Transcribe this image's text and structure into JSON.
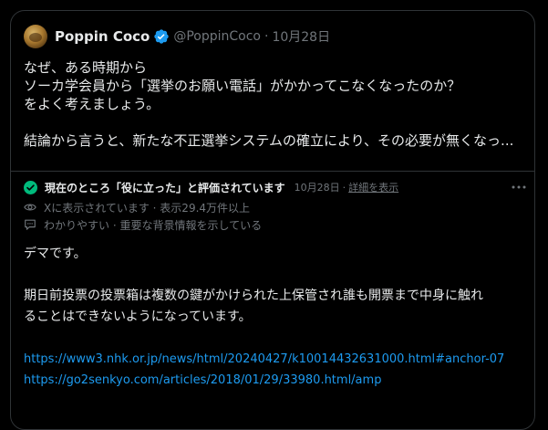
{
  "tweet": {
    "author": {
      "display_name": "Poppin Coco",
      "handle": "@PoppinCoco",
      "verified": true
    },
    "separator": "·",
    "date": "10月28日",
    "lines": [
      "なぜ、ある時期から",
      "ソーカ学会員から「選挙のお願い電話」がかかってこなくなったのか？",
      "をよく考えましょう。",
      "結論から言うと、新たな不正選挙システムの確立により、その必要が無くなっ..."
    ]
  },
  "community_note": {
    "status": "現在のところ「役に立った」と評価されています",
    "date": "10月28日",
    "separator": "·",
    "details_link": "詳細を表示",
    "views_text": "Xに表示されています · 表示29.4万件以上",
    "reason_text": "わかりやすい · 重要な背景情報を示している",
    "body": [
      "デマです。",
      "期日前投票の投票箱は複数の鍵がかけられた上保管され誰も開票まで中身に触れ",
      "ることはできないようになっています。"
    ],
    "links": [
      "https://www3.nhk.or.jp/news/html/20240427/k10014432631000.html#anchor-07",
      "https://go2senkyo.com/articles/2018/01/29/33980.html/amp"
    ]
  },
  "colors": {
    "background": "#000000",
    "text_primary": "#e7e9ea",
    "text_secondary": "#71767b",
    "border": "#2f3336",
    "link": "#1d9bf0",
    "verified": "#1d9bf0",
    "note_check": "#00ba7c"
  },
  "icons": {
    "verified": "verified-badge-icon",
    "check": "check-circle-icon",
    "eye": "eye-icon",
    "chat": "chat-bubble-icon",
    "more": "more-horizontal-icon"
  }
}
